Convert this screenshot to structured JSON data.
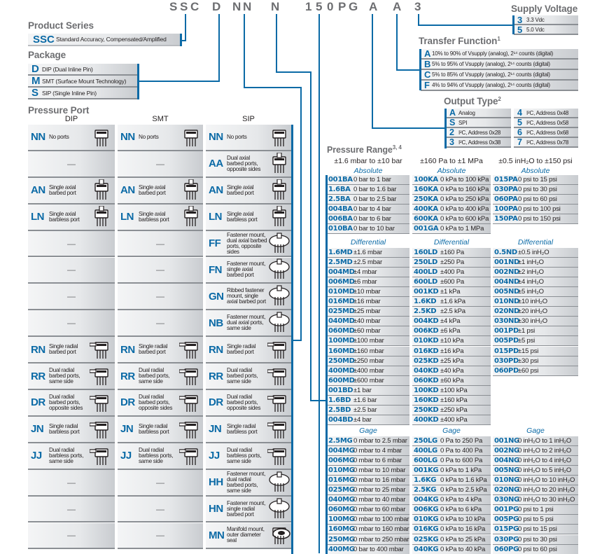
{
  "part_number": {
    "letters": [
      "S",
      "S",
      "C",
      "D",
      "N",
      "N",
      "N",
      "1",
      "5",
      "0",
      "P",
      "G",
      "A",
      "A",
      "3"
    ]
  },
  "product_series": {
    "title": "Product Series",
    "items": [
      {
        "code": "SSC",
        "desc": "Standard Accuracy, Compensated/Amplified"
      }
    ]
  },
  "package": {
    "title": "Package",
    "items": [
      {
        "code": "D",
        "desc": "DIP (Dual Inline Pin)"
      },
      {
        "code": "M",
        "desc": "SMT (Surface Mount Technology)"
      },
      {
        "code": "S",
        "desc": "SIP (Single Inline Pin)"
      }
    ]
  },
  "supply_voltage": {
    "title": "Supply Voltage",
    "items": [
      {
        "code": "3",
        "desc": "3.3 Vdc"
      },
      {
        "code": "5",
        "desc": "5.0 Vdc"
      }
    ]
  },
  "transfer_function": {
    "title": "Transfer Function",
    "note": "1",
    "items": [
      {
        "code": "A",
        "desc": "10% to 90% of Vsupply (analog), 2¹⁴ counts (digital)"
      },
      {
        "code": "B",
        "desc": "5% to 95% of Vsupply (analog), 2¹⁴ counts (digital)"
      },
      {
        "code": "C",
        "desc": "5% to 85% of Vsupply (analog), 2¹⁴ counts (digital)"
      },
      {
        "code": "F",
        "desc": "4% to 94% of Vsupply (analog), 2¹⁴ counts (digital)"
      }
    ]
  },
  "output_type": {
    "title": "Output Type",
    "note": "2",
    "left": [
      {
        "code": "A",
        "desc": "Analog"
      },
      {
        "code": "S",
        "desc": "SPI"
      },
      {
        "code": "2",
        "desc": "I²C, Address 0x28"
      },
      {
        "code": "3",
        "desc": "I²C, Address 0x38"
      }
    ],
    "right": [
      {
        "code": "4",
        "desc": "I²C, Address 0x48"
      },
      {
        "code": "5",
        "desc": "I²C, Address 0x58"
      },
      {
        "code": "6",
        "desc": "I²C, Address 0x68"
      },
      {
        "code": "7",
        "desc": "I²C, Address 0x78"
      }
    ]
  },
  "pressure_port": {
    "title": "Pressure Port",
    "columns": [
      "DIP",
      "SMT",
      "SIP"
    ],
    "dash": "—",
    "rows": [
      {
        "dip": {
          "code": "NN",
          "desc": "No ports",
          "icon": "dip-package-icon"
        },
        "smt": {
          "code": "NN",
          "desc": "No ports",
          "icon": "smt-package-icon"
        },
        "sip": {
          "code": "NN",
          "desc": "No ports",
          "icon": "sip-package-icon"
        }
      },
      {
        "dip": null,
        "smt": null,
        "sip": {
          "code": "AA",
          "desc": "Dual axial barbed ports, opposite sides",
          "icon": "dual-axial-port-icon"
        }
      },
      {
        "dip": {
          "code": "AN",
          "desc": "Single axial barbed port",
          "icon": "axial-barbed-port-icon"
        },
        "smt": {
          "code": "AN",
          "desc": "Single axial barbed port",
          "icon": "axial-barbed-port-icon"
        },
        "sip": {
          "code": "AN",
          "desc": "Single axial barbed port",
          "icon": "axial-barbed-port-icon"
        }
      },
      {
        "dip": {
          "code": "LN",
          "desc": "Single axial barbless port",
          "icon": "axial-barbless-port-icon"
        },
        "smt": {
          "code": "LN",
          "desc": "Single axial barbless port",
          "icon": "axial-barbless-port-icon"
        },
        "sip": {
          "code": "LN",
          "desc": "Single axial barbless port",
          "icon": "axial-barbless-port-icon"
        }
      },
      {
        "dip": null,
        "smt": null,
        "sip": {
          "code": "FF",
          "desc": "Fastener mount, dual axial barbed ports, opposite sides",
          "icon": "fastener-mount-icon"
        }
      },
      {
        "dip": null,
        "smt": null,
        "sip": {
          "code": "FN",
          "desc": "Fastener mount, single axial barbed port",
          "icon": "fastener-mount-icon"
        }
      },
      {
        "dip": null,
        "smt": null,
        "sip": {
          "code": "GN",
          "desc": "Ribbed fastener mount, single axial barbed port",
          "icon": "fastener-mount-icon"
        }
      },
      {
        "dip": null,
        "smt": null,
        "sip": {
          "code": "NB",
          "desc": "Fastener mount, dual axial ports, same side",
          "icon": "dual-port-mount-icon"
        }
      },
      {
        "dip": {
          "code": "RN",
          "desc": "Single radial barbed port",
          "icon": "radial-port-icon"
        },
        "smt": {
          "code": "RN",
          "desc": "Single radial barbed port",
          "icon": "radial-port-icon"
        },
        "sip": {
          "code": "RN",
          "desc": "Single radial barbed port",
          "icon": "radial-port-icon"
        }
      },
      {
        "dip": {
          "code": "RR",
          "desc": "Dual radial barbed ports, same side",
          "icon": "dual-radial-port-icon"
        },
        "smt": {
          "code": "RR",
          "desc": "Dual radial barbed ports, same side",
          "icon": "dual-radial-port-icon"
        },
        "sip": {
          "code": "RR",
          "desc": "Dual radial barbed ports, same side",
          "icon": "dual-radial-port-icon"
        }
      },
      {
        "dip": {
          "code": "DR",
          "desc": "Dual radial barbed ports, opposite sides",
          "icon": "dual-radial-port-icon"
        },
        "smt": {
          "code": "DR",
          "desc": "Dual radial barbed ports, opposite sides",
          "icon": "dual-radial-port-icon"
        },
        "sip": {
          "code": "DR",
          "desc": "Dual radial barbed ports, opposite sides",
          "icon": "dual-radial-port-icon"
        }
      },
      {
        "dip": {
          "code": "JN",
          "desc": "Single radial barbless port",
          "icon": "radial-barbless-port-icon"
        },
        "smt": {
          "code": "JN",
          "desc": "Single radial barbless port",
          "icon": "radial-barbless-port-icon"
        },
        "sip": {
          "code": "JN",
          "desc": "Single radial barbless port",
          "icon": "radial-barbless-port-icon"
        }
      },
      {
        "dip": {
          "code": "JJ",
          "desc": "Dual radial barbless ports, same side",
          "icon": "dual-radial-barbless-port-icon"
        },
        "smt": {
          "code": "JJ",
          "desc": "Dual radial barbless ports, same side",
          "icon": "dual-radial-barbless-port-icon"
        },
        "sip": {
          "code": "JJ",
          "desc": "Dual radial barbless ports, same side",
          "icon": "dual-radial-barbless-port-icon"
        }
      },
      {
        "dip": null,
        "smt": null,
        "sip": {
          "code": "HH",
          "desc": "Fastener mount, dual radial barbed ports, same side",
          "icon": "fastener-radial-mount-icon"
        }
      },
      {
        "dip": null,
        "smt": null,
        "sip": {
          "code": "HN",
          "desc": "Fastener mount, single radial barbed port",
          "icon": "fastener-radial-mount-icon"
        }
      },
      {
        "dip": null,
        "smt": null,
        "sip": {
          "code": "MN",
          "desc": "Manifold mount, outer diameter seal",
          "icon": "manifold-mount-icon"
        }
      }
    ]
  },
  "pressure_range": {
    "title": "Pressure Range",
    "note": "3, 4",
    "columns": [
      {
        "heading": "±1.6 mbar to ±10 bar",
        "absolute": [
          {
            "code": "001BA",
            "range": "0 bar to 1 bar"
          },
          {
            "code": "1.6BA",
            "range": "0 bar to 1.6 bar"
          },
          {
            "code": "2.5BA",
            "range": "0 bar to 2.5 bar"
          },
          {
            "code": "004BA",
            "range": "0 bar to 4 bar"
          },
          {
            "code": "006BA",
            "range": "0 bar to 6 bar"
          },
          {
            "code": "010BA",
            "range": "0 bar to 10 bar"
          }
        ],
        "differential": [
          {
            "code": "1.6MD",
            "range": "±1.6 mbar"
          },
          {
            "code": "2.5MD",
            "range": "±2.5 mbar"
          },
          {
            "code": "004MD",
            "range": "±4 mbar"
          },
          {
            "code": "006MD",
            "range": "±6 mbar"
          },
          {
            "code": "010MD",
            "range": "±10 mbar"
          },
          {
            "code": "016MD",
            "range": "±16 mbar"
          },
          {
            "code": "025MD",
            "range": "±25 mbar"
          },
          {
            "code": "040MD",
            "range": "±40 mbar"
          },
          {
            "code": "060MD",
            "range": "±60 mbar"
          },
          {
            "code": "100MD",
            "range": "±100 mbar"
          },
          {
            "code": "160MD",
            "range": "±160 mbar"
          },
          {
            "code": "250MD",
            "range": "±250 mbar"
          },
          {
            "code": "400MD",
            "range": "±400 mbar"
          },
          {
            "code": "600MD",
            "range": "±600 mbar"
          },
          {
            "code": "001BD",
            "range": "±1 bar"
          },
          {
            "code": "1.6BD",
            "range": "±1.6 bar"
          },
          {
            "code": "2.5BD",
            "range": "±2.5 bar"
          },
          {
            "code": "004BD",
            "range": "±4 bar"
          }
        ],
        "gage": [
          {
            "code": "2.5MG",
            "range": "0 mbar to 2.5 mbar"
          },
          {
            "code": "004MG",
            "range": "0 mbar to 4 mbar"
          },
          {
            "code": "006MG",
            "range": "0 mbar to 6 mbar"
          },
          {
            "code": "010MG",
            "range": "0 mbar to 10 mbar"
          },
          {
            "code": "016MG",
            "range": "0 mbar to 16 mbar"
          },
          {
            "code": "025MG",
            "range": "0 mbar to 25 mbar"
          },
          {
            "code": "040MG",
            "range": "0 mbar to 40 mbar"
          },
          {
            "code": "060MG",
            "range": "0 mbar to 60 mbar"
          },
          {
            "code": "100MG",
            "range": "0 mbar to 100 mbar"
          },
          {
            "code": "160MG",
            "range": "0 mbar to 160 mbar"
          },
          {
            "code": "250MG",
            "range": "0 mbar to 250 mbar"
          },
          {
            "code": "400MG",
            "range": "0 bar to 400 mbar"
          }
        ]
      },
      {
        "heading": "±160 Pa to ±1 MPa",
        "absolute": [
          {
            "code": "100KA",
            "range": "0 kPa to 100 kPa"
          },
          {
            "code": "160KA",
            "range": "0 kPa to 160 kPa"
          },
          {
            "code": "250KA",
            "range": "0 kPa to 250 kPa"
          },
          {
            "code": "400KA",
            "range": "0 kPa to 400 kPa"
          },
          {
            "code": "600KA",
            "range": "0 kPa to 600 kPa"
          },
          {
            "code": "001GA",
            "range": "0 kPa to 1 MPa"
          }
        ],
        "differential": [
          {
            "code": "160LD",
            "range": "±160 Pa"
          },
          {
            "code": "250LD",
            "range": "±250 Pa"
          },
          {
            "code": "400LD",
            "range": "±400 Pa"
          },
          {
            "code": "600LD",
            "range": "±600 Pa"
          },
          {
            "code": "001KD",
            "range": "±1 kPa"
          },
          {
            "code": "1.6KD",
            "range": "±1.6 kPa"
          },
          {
            "code": "2.5KD",
            "range": "±2.5 kPa"
          },
          {
            "code": "004KD",
            "range": "±4 kPa"
          },
          {
            "code": "006KD",
            "range": "±6 kPa"
          },
          {
            "code": "010KD",
            "range": "±10 kPa"
          },
          {
            "code": "016KD",
            "range": "±16 kPa"
          },
          {
            "code": "025KD",
            "range": "±25 kPa"
          },
          {
            "code": "040KD",
            "range": "±40 kPa"
          },
          {
            "code": "060KD",
            "range": "±60 kPa"
          },
          {
            "code": "100KD",
            "range": "±100 kPa"
          },
          {
            "code": "160KD",
            "range": "±160 kPa"
          },
          {
            "code": "250KD",
            "range": "±250 kPa"
          },
          {
            "code": "400KD",
            "range": "±400 kPa"
          }
        ],
        "gage": [
          {
            "code": "250LG",
            "range": "0 Pa to 250 Pa"
          },
          {
            "code": "400LG",
            "range": "0 Pa to 400 Pa"
          },
          {
            "code": "600LG",
            "range": "0 Pa to 600 Pa"
          },
          {
            "code": "001KG",
            "range": "0 kPa to 1 kPa"
          },
          {
            "code": "1.6KG",
            "range": "0 kPa to 1.6 kPa"
          },
          {
            "code": "2.5KG",
            "range": "0 kPa to 2.5 kPa"
          },
          {
            "code": "004KG",
            "range": "0 kPa to 4 kPa"
          },
          {
            "code": "006KG",
            "range": "0 kPa to 6 kPa"
          },
          {
            "code": "010KG",
            "range": "0 kPa to 10 kPa"
          },
          {
            "code": "016KG",
            "range": "0 kPa to 16 kPa"
          },
          {
            "code": "025KG",
            "range": "0 kPa to 25 kPa"
          },
          {
            "code": "040KG",
            "range": "0 kPa to 40 kPa"
          }
        ]
      },
      {
        "heading": "±0.5 inH₂O to ±150 psi",
        "absolute": [
          {
            "code": "015PA",
            "range": "0 psi to 15 psi"
          },
          {
            "code": "030PA",
            "range": "0 psi to 30 psi"
          },
          {
            "code": "060PA",
            "range": "0 psi to 60 psi"
          },
          {
            "code": "100PA",
            "range": "0 psi to 100 psi"
          },
          {
            "code": "150PA",
            "range": "0 psi to 150 psi"
          }
        ],
        "differential": [
          {
            "code": "0.5ND",
            "range": "±0.5 inH₂O"
          },
          {
            "code": "001ND",
            "range": "±1 inH₂O"
          },
          {
            "code": "002ND",
            "range": "±2 inH₂O"
          },
          {
            "code": "004ND",
            "range": "±4 inH₂O"
          },
          {
            "code": "005ND",
            "range": "±5 inH₂O"
          },
          {
            "code": "010ND",
            "range": "±10 inH₂O"
          },
          {
            "code": "020ND",
            "range": "±20 inH₂O"
          },
          {
            "code": "030ND",
            "range": "±30 inH₂O"
          },
          {
            "code": "001PD",
            "range": "±1 psi"
          },
          {
            "code": "005PD",
            "range": "±5 psi"
          },
          {
            "code": "015PD",
            "range": "±15 psi"
          },
          {
            "code": "030PD",
            "range": "±30 psi"
          },
          {
            "code": "060PD",
            "range": "±60 psi"
          }
        ],
        "gage": [
          {
            "code": "001NG",
            "range": "0 inH₂O to 1 inH₂O"
          },
          {
            "code": "002NG",
            "range": "0 inH₂O to 2 inH₂O"
          },
          {
            "code": "004NG",
            "range": "0 inH₂O to 4 inH₂O"
          },
          {
            "code": "005NG",
            "range": "0 inH₂O to 5 inH₂O"
          },
          {
            "code": "010NG",
            "range": "0 inH₂O to 10 inH₂O"
          },
          {
            "code": "020NG",
            "range": "0 inH₂O to 20 inH₂O"
          },
          {
            "code": "030NG",
            "range": "0 inH₂O to 30 inH₂O"
          },
          {
            "code": "001PG",
            "range": "0 psi to 1 psi"
          },
          {
            "code": "005PG",
            "range": "0 psi to 5 psi"
          },
          {
            "code": "015PG",
            "range": "0 psi to 15 psi"
          },
          {
            "code": "030PG",
            "range": "0 psi to 30 psi"
          },
          {
            "code": "060PG",
            "range": "0 psi to 60 psi"
          }
        ]
      }
    ],
    "category_labels": {
      "absolute": "Absolute",
      "differential": "Differential",
      "gage": "Gage"
    }
  }
}
